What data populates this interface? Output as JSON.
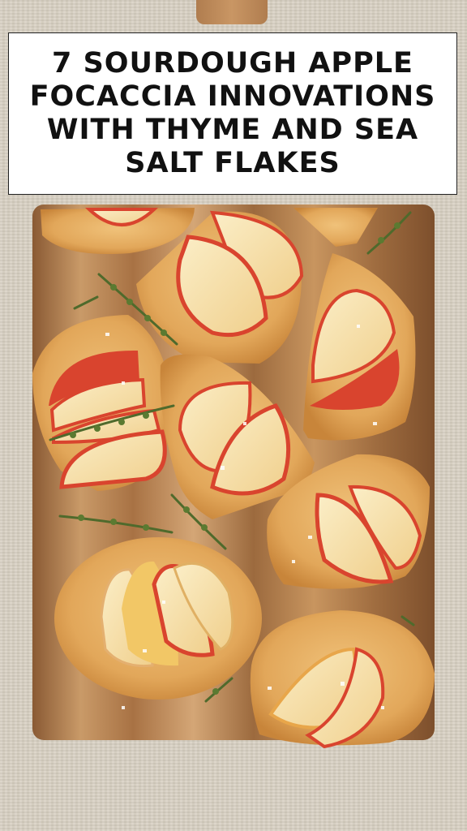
{
  "title": "7 SOURDOUGH APPLE FOCACCIA INNOVATIONS WITH THYME AND SEA SALT FLAKES",
  "image": {
    "pieces": [
      "focaccia-top-left",
      "focaccia-top-center",
      "focaccia-top-right",
      "focaccia-middle-left",
      "focaccia-middle-center",
      "focaccia-middle-right",
      "focaccia-right-lower",
      "focaccia-bottom-left",
      "focaccia-bottom-right"
    ]
  },
  "colors": {
    "board": "#b98a5c",
    "bread": "#e0a85c",
    "apple_flesh": "#f6e2b0",
    "apple_skin": "#d9442e",
    "thyme": "#4f6a2c",
    "linen": "#d8d0c2"
  }
}
